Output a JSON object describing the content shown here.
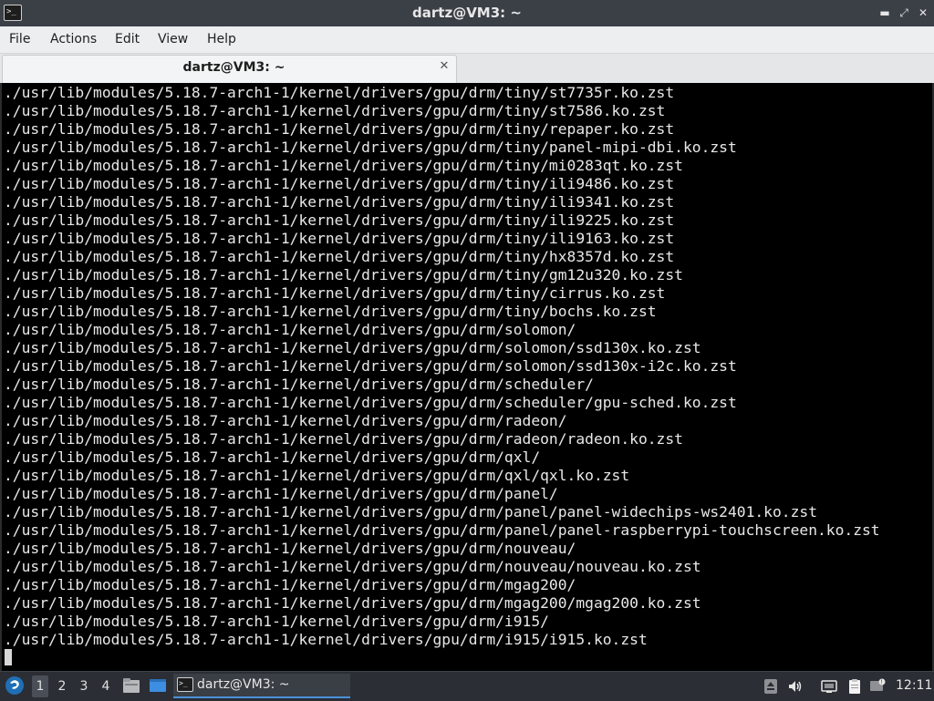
{
  "window": {
    "title": "dartz@VM3: ~",
    "app_icon_glyph": ">_",
    "minimize_glyph": "▬",
    "maximize_glyph": "⤢",
    "close_glyph": "✕"
  },
  "menu": {
    "items": [
      "File",
      "Actions",
      "Edit",
      "View",
      "Help"
    ]
  },
  "tab": {
    "label": "dartz@VM3: ~",
    "close_glyph": "✕"
  },
  "terminal": {
    "lines": [
      "./usr/lib/modules/5.18.7-arch1-1/kernel/drivers/gpu/drm/tiny/st7735r.ko.zst",
      "./usr/lib/modules/5.18.7-arch1-1/kernel/drivers/gpu/drm/tiny/st7586.ko.zst",
      "./usr/lib/modules/5.18.7-arch1-1/kernel/drivers/gpu/drm/tiny/repaper.ko.zst",
      "./usr/lib/modules/5.18.7-arch1-1/kernel/drivers/gpu/drm/tiny/panel-mipi-dbi.ko.zst",
      "./usr/lib/modules/5.18.7-arch1-1/kernel/drivers/gpu/drm/tiny/mi0283qt.ko.zst",
      "./usr/lib/modules/5.18.7-arch1-1/kernel/drivers/gpu/drm/tiny/ili9486.ko.zst",
      "./usr/lib/modules/5.18.7-arch1-1/kernel/drivers/gpu/drm/tiny/ili9341.ko.zst",
      "./usr/lib/modules/5.18.7-arch1-1/kernel/drivers/gpu/drm/tiny/ili9225.ko.zst",
      "./usr/lib/modules/5.18.7-arch1-1/kernel/drivers/gpu/drm/tiny/ili9163.ko.zst",
      "./usr/lib/modules/5.18.7-arch1-1/kernel/drivers/gpu/drm/tiny/hx8357d.ko.zst",
      "./usr/lib/modules/5.18.7-arch1-1/kernel/drivers/gpu/drm/tiny/gm12u320.ko.zst",
      "./usr/lib/modules/5.18.7-arch1-1/kernel/drivers/gpu/drm/tiny/cirrus.ko.zst",
      "./usr/lib/modules/5.18.7-arch1-1/kernel/drivers/gpu/drm/tiny/bochs.ko.zst",
      "./usr/lib/modules/5.18.7-arch1-1/kernel/drivers/gpu/drm/solomon/",
      "./usr/lib/modules/5.18.7-arch1-1/kernel/drivers/gpu/drm/solomon/ssd130x.ko.zst",
      "./usr/lib/modules/5.18.7-arch1-1/kernel/drivers/gpu/drm/solomon/ssd130x-i2c.ko.zst",
      "./usr/lib/modules/5.18.7-arch1-1/kernel/drivers/gpu/drm/scheduler/",
      "./usr/lib/modules/5.18.7-arch1-1/kernel/drivers/gpu/drm/scheduler/gpu-sched.ko.zst",
      "./usr/lib/modules/5.18.7-arch1-1/kernel/drivers/gpu/drm/radeon/",
      "./usr/lib/modules/5.18.7-arch1-1/kernel/drivers/gpu/drm/radeon/radeon.ko.zst",
      "./usr/lib/modules/5.18.7-arch1-1/kernel/drivers/gpu/drm/qxl/",
      "./usr/lib/modules/5.18.7-arch1-1/kernel/drivers/gpu/drm/qxl/qxl.ko.zst",
      "./usr/lib/modules/5.18.7-arch1-1/kernel/drivers/gpu/drm/panel/",
      "./usr/lib/modules/5.18.7-arch1-1/kernel/drivers/gpu/drm/panel/panel-widechips-ws2401.ko.zst",
      "./usr/lib/modules/5.18.7-arch1-1/kernel/drivers/gpu/drm/panel/panel-raspberrypi-touchscreen.ko.zst",
      "./usr/lib/modules/5.18.7-arch1-1/kernel/drivers/gpu/drm/nouveau/",
      "./usr/lib/modules/5.18.7-arch1-1/kernel/drivers/gpu/drm/nouveau/nouveau.ko.zst",
      "./usr/lib/modules/5.18.7-arch1-1/kernel/drivers/gpu/drm/mgag200/",
      "./usr/lib/modules/5.18.7-arch1-1/kernel/drivers/gpu/drm/mgag200/mgag200.ko.zst",
      "./usr/lib/modules/5.18.7-arch1-1/kernel/drivers/gpu/drm/i915/",
      "./usr/lib/modules/5.18.7-arch1-1/kernel/drivers/gpu/drm/i915/i915.ko.zst"
    ]
  },
  "taskbar": {
    "start_icon": "lxqt-start-icon",
    "workspaces": [
      "1",
      "2",
      "3",
      "4"
    ],
    "active_workspace": "1",
    "launchers": [
      "file-manager-icon",
      "show-desktop-icon"
    ],
    "task": {
      "label": "dartz@VM3: ~",
      "icon": "terminal-icon",
      "icon_glyph": ">_"
    },
    "tray": [
      "eject-icon",
      "volume-icon",
      "network-icon",
      "clipboard-icon",
      "notification-icon"
    ],
    "clock": "12:11"
  },
  "colors": {
    "titlebar": "#3b3f46",
    "terminal_bg": "#000000",
    "terminal_fg": "#e8e8e8",
    "taskbar": "#2b2e34",
    "accent": "#4a90d9"
  }
}
